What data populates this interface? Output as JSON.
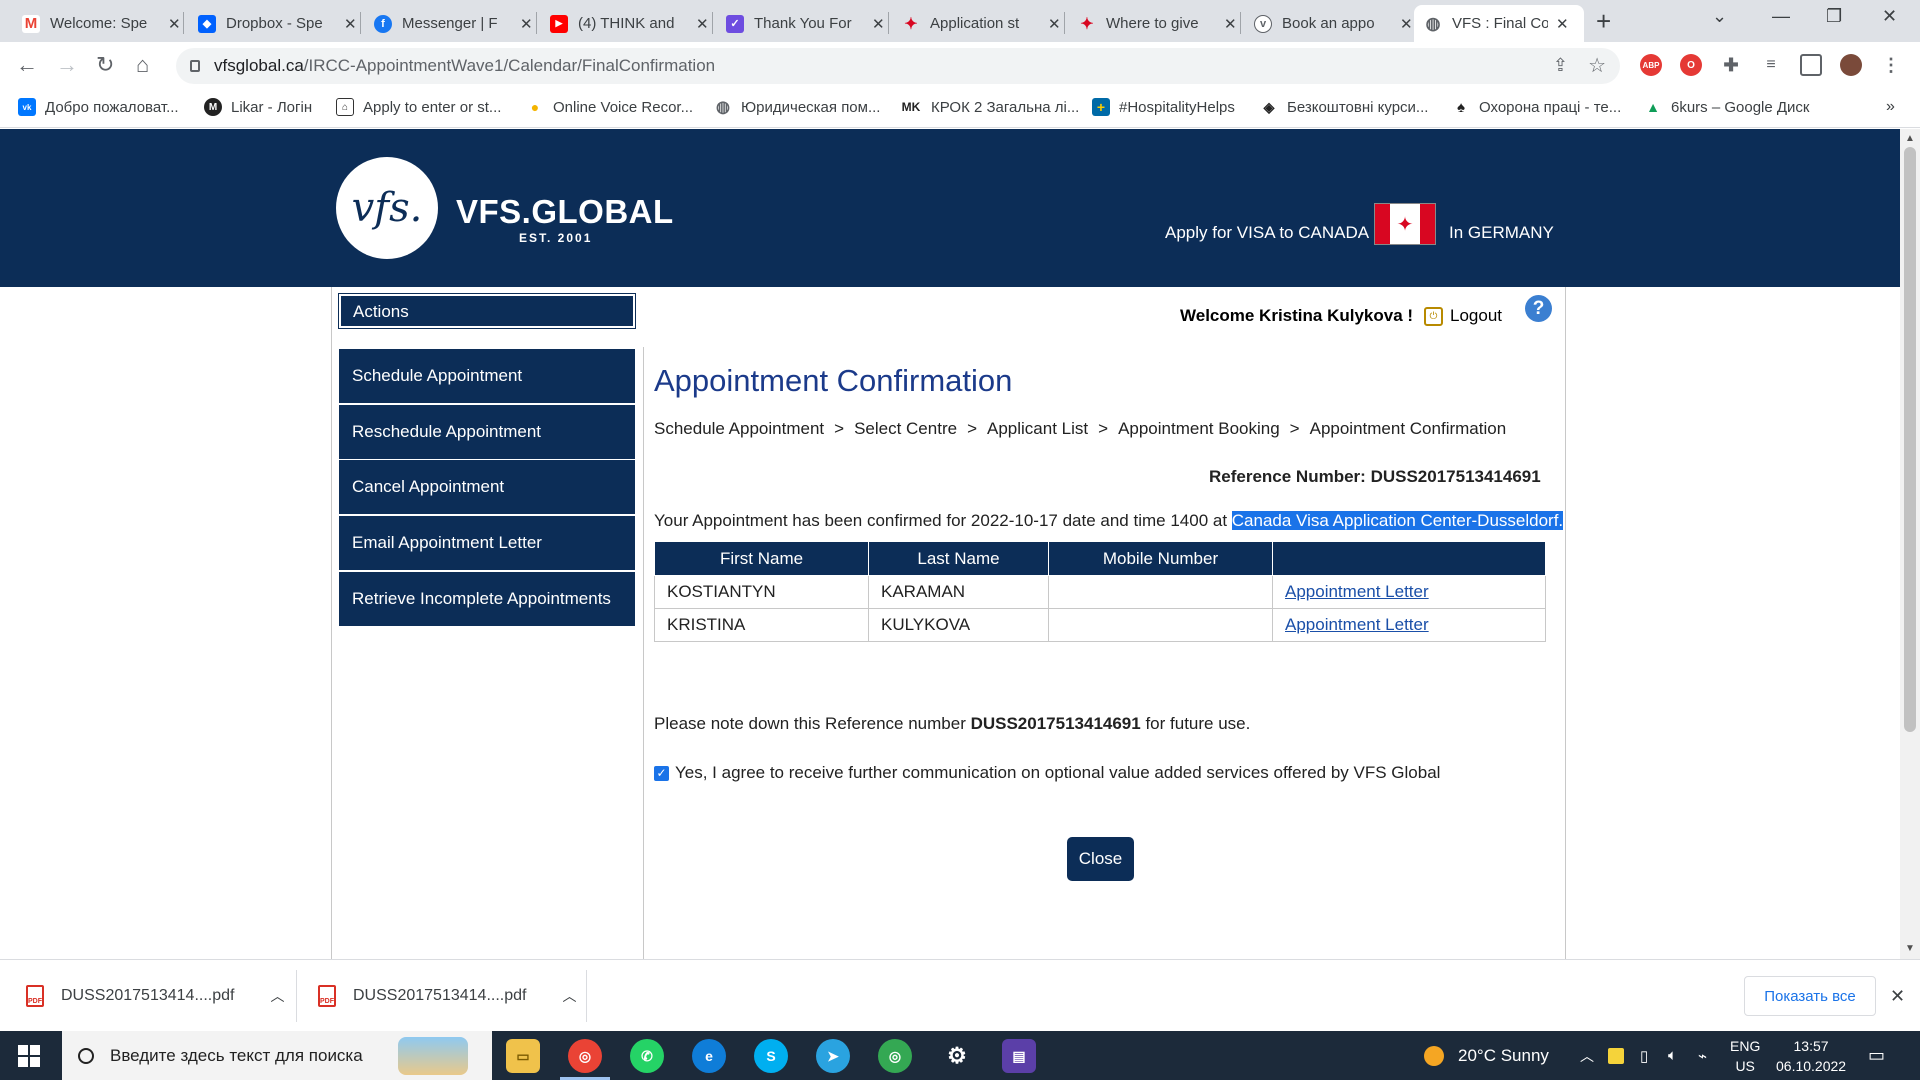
{
  "browser": {
    "tabs": [
      {
        "title": "Welcome: Spe",
        "icon": "gmail-icon",
        "color": "#ea4335",
        "glyph": "M"
      },
      {
        "title": "Dropbox - Spe",
        "icon": "dropbox-icon",
        "color": "#0061fe",
        "glyph": "◆"
      },
      {
        "title": "Messenger | F",
        "icon": "facebook-icon",
        "color": "#1877f2",
        "glyph": "f"
      },
      {
        "title": "(4) THINK and",
        "icon": "youtube-icon",
        "color": "#ff0000",
        "glyph": "▶"
      },
      {
        "title": "Thank You For",
        "icon": "form-icon",
        "color": "#6e4de0",
        "glyph": "✓"
      },
      {
        "title": "Application st",
        "icon": "canada-leaf-icon",
        "color": "#d80621",
        "glyph": "✦"
      },
      {
        "title": "Where to give",
        "icon": "canada-leaf-icon",
        "color": "#d80621",
        "glyph": "✦"
      },
      {
        "title": "Book an appo",
        "icon": "vfs-icon",
        "color": "#5f6368",
        "glyph": "v"
      },
      {
        "title": "VFS : Final Co",
        "icon": "globe-icon",
        "color": "#5f6368",
        "glyph": "◍"
      }
    ],
    "url_host": "vfsglobal.ca",
    "url_path": "/IRCC-AppointmentWave1/Calendar/FinalConfirmation"
  },
  "bookmarks": [
    {
      "label": "Добро пожаловат...",
      "icon": "vk-icon",
      "color": "#0077ff",
      "glyph": "vk"
    },
    {
      "label": "Likar - Логін",
      "icon": "likar-icon",
      "color": "#222222",
      "glyph": "M"
    },
    {
      "label": "Apply to enter or st...",
      "icon": "gov-icon",
      "color": "#333333",
      "glyph": "⌂"
    },
    {
      "label": "Online Voice Recor...",
      "icon": "recorder-icon",
      "color": "#f4b400",
      "glyph": "●"
    },
    {
      "label": "Юридическая пом...",
      "icon": "globe-icon",
      "color": "#5f6368",
      "glyph": "◍"
    },
    {
      "label": "КРОК 2 Загальна лі...",
      "icon": "mk-icon",
      "color": "#ffffff",
      "glyph": "MK"
    },
    {
      "label": "#HospitalityHelps",
      "icon": "sweden-flag-icon",
      "color": "#006aa7",
      "glyph": "+"
    },
    {
      "label": "Безкоштовні курси...",
      "icon": "edu-icon",
      "color": "#222222",
      "glyph": "◈"
    },
    {
      "label": "Охорона праці - те...",
      "icon": "safety-icon",
      "color": "#222222",
      "glyph": "♠"
    },
    {
      "label": "6kurs – Google Диск",
      "icon": "google-drive-icon",
      "color": "#0f9d58",
      "glyph": "▲"
    }
  ],
  "site": {
    "logo_mark": "vfs.",
    "logo_name": "VFS.GLOBAL",
    "logo_est": "EST. 2001",
    "apply_text": "Apply for VISA to CANADA",
    "country_text": "In GERMANY"
  },
  "sidebar": {
    "header": "Actions",
    "items": [
      "Schedule Appointment",
      "Reschedule Appointment",
      "Cancel Appointment",
      "Email Appointment Letter",
      "Retrieve Incomplete Appointments"
    ]
  },
  "user": {
    "welcome": "Welcome Kristina Kulykova !",
    "logout": "Logout",
    "help": "?"
  },
  "main": {
    "title": "Appointment Confirmation",
    "breadcrumb": [
      "Schedule Appointment",
      "Select Centre",
      "Applicant List",
      "Appointment Booking",
      "Appointment Confirmation"
    ],
    "reference_label": "Reference Number:",
    "reference_number": "DUSS2017513414691",
    "confirm_text": "Your Appointment has been confirmed for 2022-10-17 date and time 1400 at ",
    "confirm_centre": "Canada Visa Application Center-Dusseldorf.",
    "table": {
      "headers": [
        "First Name",
        "Last Name",
        "Mobile Number",
        ""
      ],
      "rows": [
        {
          "first": "KOSTIANTYN",
          "last": "KARAMAN",
          "mobile": "",
          "link": "Appointment Letter"
        },
        {
          "first": "KRISTINA",
          "last": "KULYKOVA",
          "mobile": "",
          "link": "Appointment Letter"
        }
      ]
    },
    "note_before": "Please note down this Reference number ",
    "note_number": "DUSS2017513414691",
    "note_after": " for future use.",
    "consent": "Yes, I agree to receive further communication on optional value added services offered by VFS Global",
    "consent_checked": true,
    "close_label": "Close"
  },
  "downloads": {
    "items": [
      "DUSS2017513414....pdf",
      "DUSS2017513414....pdf"
    ],
    "show_all": "Показать все"
  },
  "taskbar": {
    "search_placeholder": "Введите здесь текст для поиска",
    "weather": "20°C  Sunny",
    "lang_top": "ENG",
    "lang_bottom": "US",
    "time": "13:57",
    "date": "06.10.2022"
  },
  "colors": {
    "brand_navy": "#0c2d57",
    "title_blue": "#1b3a8a",
    "link_blue": "#1a4fa8",
    "selection_blue": "#1a73e8"
  }
}
